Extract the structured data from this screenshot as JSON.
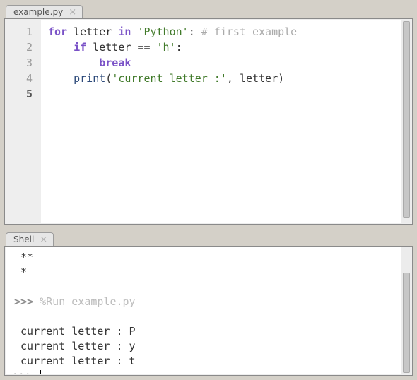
{
  "editor": {
    "tab_label": "example.py",
    "lines": [
      {
        "n": 1,
        "current": false,
        "tokens": [
          {
            "t": "kw",
            "v": "for"
          },
          {
            "t": "sp",
            "v": " "
          },
          {
            "t": "name",
            "v": "letter"
          },
          {
            "t": "sp",
            "v": " "
          },
          {
            "t": "kw",
            "v": "in"
          },
          {
            "t": "sp",
            "v": " "
          },
          {
            "t": "str",
            "v": "'Python'"
          },
          {
            "t": "op",
            "v": ":"
          },
          {
            "t": "sp",
            "v": " "
          },
          {
            "t": "cmt",
            "v": "# first example"
          }
        ]
      },
      {
        "n": 2,
        "current": false,
        "tokens": [
          {
            "t": "sp",
            "v": "    "
          },
          {
            "t": "kw",
            "v": "if"
          },
          {
            "t": "sp",
            "v": " "
          },
          {
            "t": "name",
            "v": "letter"
          },
          {
            "t": "sp",
            "v": " "
          },
          {
            "t": "op",
            "v": "=="
          },
          {
            "t": "sp",
            "v": " "
          },
          {
            "t": "str",
            "v": "'h'"
          },
          {
            "t": "op",
            "v": ":"
          }
        ]
      },
      {
        "n": 3,
        "current": false,
        "tokens": [
          {
            "t": "sp",
            "v": "        "
          },
          {
            "t": "kw",
            "v": "break"
          }
        ]
      },
      {
        "n": 4,
        "current": false,
        "tokens": [
          {
            "t": "sp",
            "v": "    "
          },
          {
            "t": "func",
            "v": "print"
          },
          {
            "t": "op",
            "v": "("
          },
          {
            "t": "str",
            "v": "'current letter :'"
          },
          {
            "t": "op",
            "v": ","
          },
          {
            "t": "sp",
            "v": " "
          },
          {
            "t": "name",
            "v": "letter"
          },
          {
            "t": "op",
            "v": ")"
          }
        ]
      },
      {
        "n": 5,
        "current": true,
        "tokens": []
      }
    ]
  },
  "shell": {
    "tab_label": "Shell",
    "prompt": ">>> ",
    "lines": [
      {
        "kind": "stars",
        "text": " **"
      },
      {
        "kind": "stars",
        "text": " *"
      },
      {
        "kind": "blank",
        "text": ""
      },
      {
        "kind": "cmd",
        "magic": "%Run example.py"
      },
      {
        "kind": "blank",
        "text": ""
      },
      {
        "kind": "out",
        "text": " current letter : P"
      },
      {
        "kind": "out",
        "text": " current letter : y"
      },
      {
        "kind": "out",
        "text": " current letter : t"
      },
      {
        "kind": "prompt"
      }
    ]
  }
}
